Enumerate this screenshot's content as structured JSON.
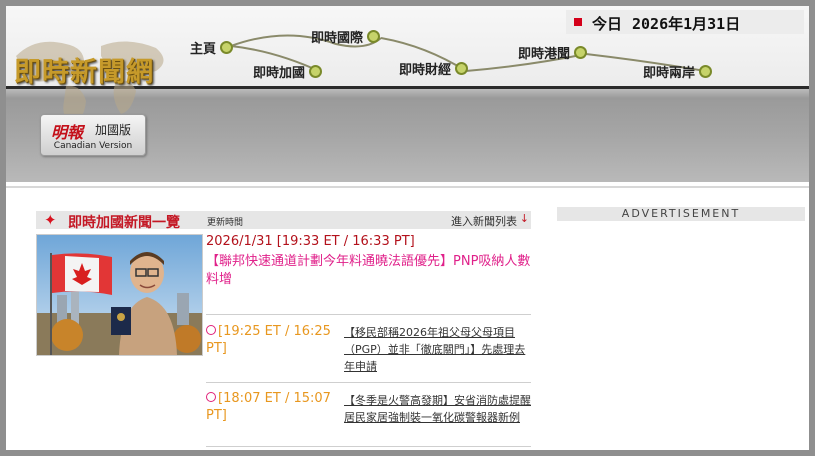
{
  "site": {
    "title": "即時新聞網"
  },
  "date": {
    "label": "今日",
    "value": "2026年1月31日",
    "marker_color": "#d4001a"
  },
  "nav": [
    {
      "label": "主頁"
    },
    {
      "label": "即時加國"
    },
    {
      "label": "即時國際"
    },
    {
      "label": "即時財經"
    },
    {
      "label": "即時港聞"
    },
    {
      "label": "即時兩岸"
    }
  ],
  "badge": {
    "logo": "明報",
    "edition": "加國版",
    "english": "Canadian Version"
  },
  "news": {
    "section_title": "即時加國新聞一覽",
    "updated_label": "更新時間",
    "enter_list": "進入新聞列表",
    "lead": {
      "time": "2026/1/31 [19:33 ET / 16:33 PT]",
      "headline": "【聯邦快速通道計劃今年料通曉法語優先】PNP吸納人數料增"
    },
    "items": [
      {
        "time": "[19:25 ET / 16:25 PT]",
        "headline": "【移民部稱2026年祖父母父母項目（PGP）並非「徹底關門」】先處理去年申請"
      },
      {
        "time": "[18:07 ET / 15:07 PT]",
        "headline": "【冬季是火警高發期】安省消防處提醒居民家居強制裝一氧化碳警報器新例"
      }
    ]
  },
  "ad": {
    "label": "ADVERTISEMENT"
  },
  "colors": {
    "accent_red": "#c41825",
    "headline_pink": "#e0218a",
    "time_orange": "#e8971f",
    "gold": "#c69a2a"
  }
}
